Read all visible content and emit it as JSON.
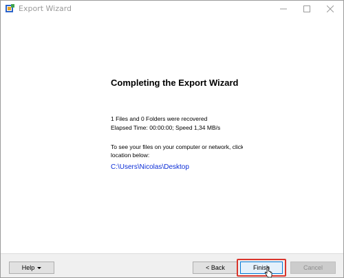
{
  "window": {
    "title": "Export Wizard",
    "title_color": "#9a9a9a"
  },
  "content": {
    "heading": "Completing the Export Wizard",
    "recovered": "1 Files and 0 Folders were recovered",
    "elapsed": "Elapsed Time: 00:00:00; Speed 1,34 MB/s",
    "instruction_line1": "To see your files on your computer or network, click the",
    "instruction_line2": "location below:",
    "location": "C:\\Users\\Nicolas\\Desktop",
    "link_color": "#0b2dd6"
  },
  "footer": {
    "help_label": "Help",
    "back_label": "< Back",
    "finish_label": "Finish",
    "cancel_label": "Cancel",
    "highlight_color": "#d9342b"
  },
  "icons": {
    "app": "export-wizard-app-icon",
    "minimize": "minimize-icon",
    "maximize": "maximize-icon",
    "close": "close-icon",
    "help_dropdown": "chevron-down-icon",
    "cursor": "hand-cursor-icon"
  }
}
